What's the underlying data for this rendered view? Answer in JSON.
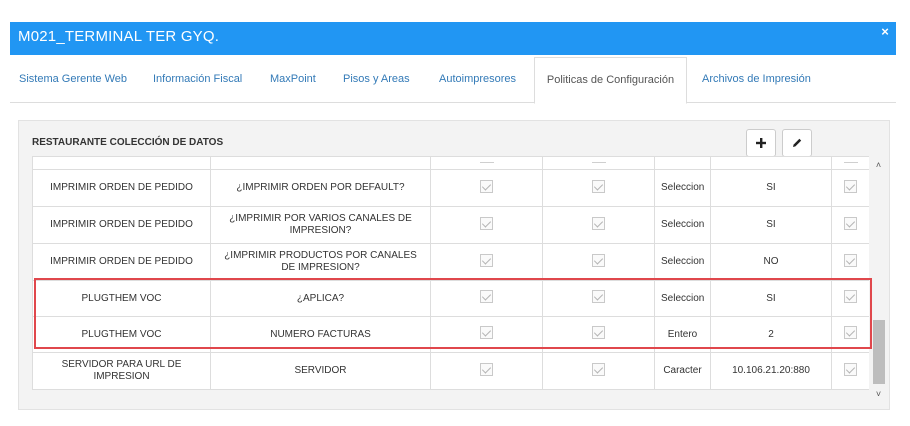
{
  "window": {
    "title": "M021_TERMINAL TER GYQ.",
    "close_glyph": "×"
  },
  "tabs": [
    {
      "label": "Sistema Gerente Web"
    },
    {
      "label": "Información Fiscal"
    },
    {
      "label": "MaxPoint"
    },
    {
      "label": "Pisos y Areas"
    },
    {
      "label": "Autoimpresores"
    },
    {
      "label": "Politicas de Configuración",
      "active": true
    },
    {
      "label": "Archivos de Impresión"
    }
  ],
  "panel": {
    "title": "RESTAURANTE COLECCIÓN DE DATOS",
    "add_icon": "plus-icon",
    "edit_icon": "pencil-icon"
  },
  "rows": [
    {
      "coleccion": "IMPRIMIR ORDEN DE PEDIDO",
      "parametro": "¿IMPRIMIR ORDEN POR DEFAULT?",
      "chk1": true,
      "chk2": true,
      "tipo": "Seleccion",
      "valor": "SI",
      "chk3": true
    },
    {
      "coleccion": "IMPRIMIR ORDEN DE PEDIDO",
      "parametro": "¿IMPRIMIR POR VARIOS CANALES DE IMPRESION?",
      "chk1": true,
      "chk2": true,
      "tipo": "Seleccion",
      "valor": "SI",
      "chk3": true
    },
    {
      "coleccion": "IMPRIMIR ORDEN DE PEDIDO",
      "parametro": "¿IMPRIMIR PRODUCTOS POR CANALES DE IMPRESION?",
      "chk1": true,
      "chk2": true,
      "tipo": "Seleccion",
      "valor": "NO",
      "chk3": true
    },
    {
      "coleccion": "PLUGTHEM VOC",
      "parametro": "¿APLICA?",
      "chk1": true,
      "chk2": true,
      "tipo": "Seleccion",
      "valor": "SI",
      "chk3": true
    },
    {
      "coleccion": "PLUGTHEM VOC",
      "parametro": "NUMERO FACTURAS",
      "chk1": true,
      "chk2": true,
      "tipo": "Entero",
      "valor": "2",
      "chk3": true
    },
    {
      "coleccion": "SERVIDOR PARA URL DE IMPRESION",
      "parametro": "SERVIDOR",
      "chk1": true,
      "chk2": true,
      "tipo": "Caracter",
      "valor": "10.106.21.20:880",
      "chk3": true
    }
  ],
  "colors": {
    "titlebar": "#2196f3",
    "highlight": "#e0474c",
    "link": "#337ab7"
  }
}
